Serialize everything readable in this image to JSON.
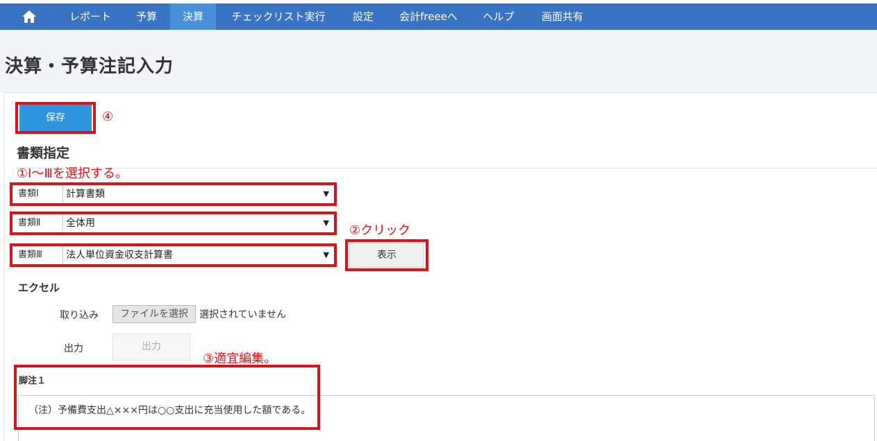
{
  "nav": {
    "home_icon": "home-icon",
    "items": [
      "レポート",
      "予算",
      "決算",
      "チェックリスト実行",
      "設定",
      "会計freeeへ",
      "ヘルプ",
      "画面共有"
    ],
    "active": "決算",
    "color": "#3b73c4",
    "active_color": "#4a90d9"
  },
  "page": {
    "title": "決算・予算注記入力"
  },
  "toolbar": {
    "save_label": "保存"
  },
  "doc_spec": {
    "title": "書類指定",
    "rows": [
      {
        "label": "書類Ⅰ",
        "value": "計算書類"
      },
      {
        "label": "書類Ⅱ",
        "value": "全体用"
      },
      {
        "label": "書類Ⅲ",
        "value": "法人単位資金収支計算書"
      }
    ],
    "show_button": "表示",
    "caret": "▼"
  },
  "excel": {
    "title": "エクセル",
    "import_label": "取り込み",
    "file_button": "ファイルを選択",
    "file_status": "選択されていません",
    "export_label": "出力",
    "export_button": "出力"
  },
  "footnote": {
    "label": "脚注１",
    "text": "（注）予備費支出△×××円は○○支出に充当使用した額である。"
  },
  "annotations": {
    "step1": "①I～Ⅲを選択する。",
    "step2": "②クリック",
    "step3": "③適宜編集。",
    "step4": "④",
    "color": "#d8141b"
  }
}
